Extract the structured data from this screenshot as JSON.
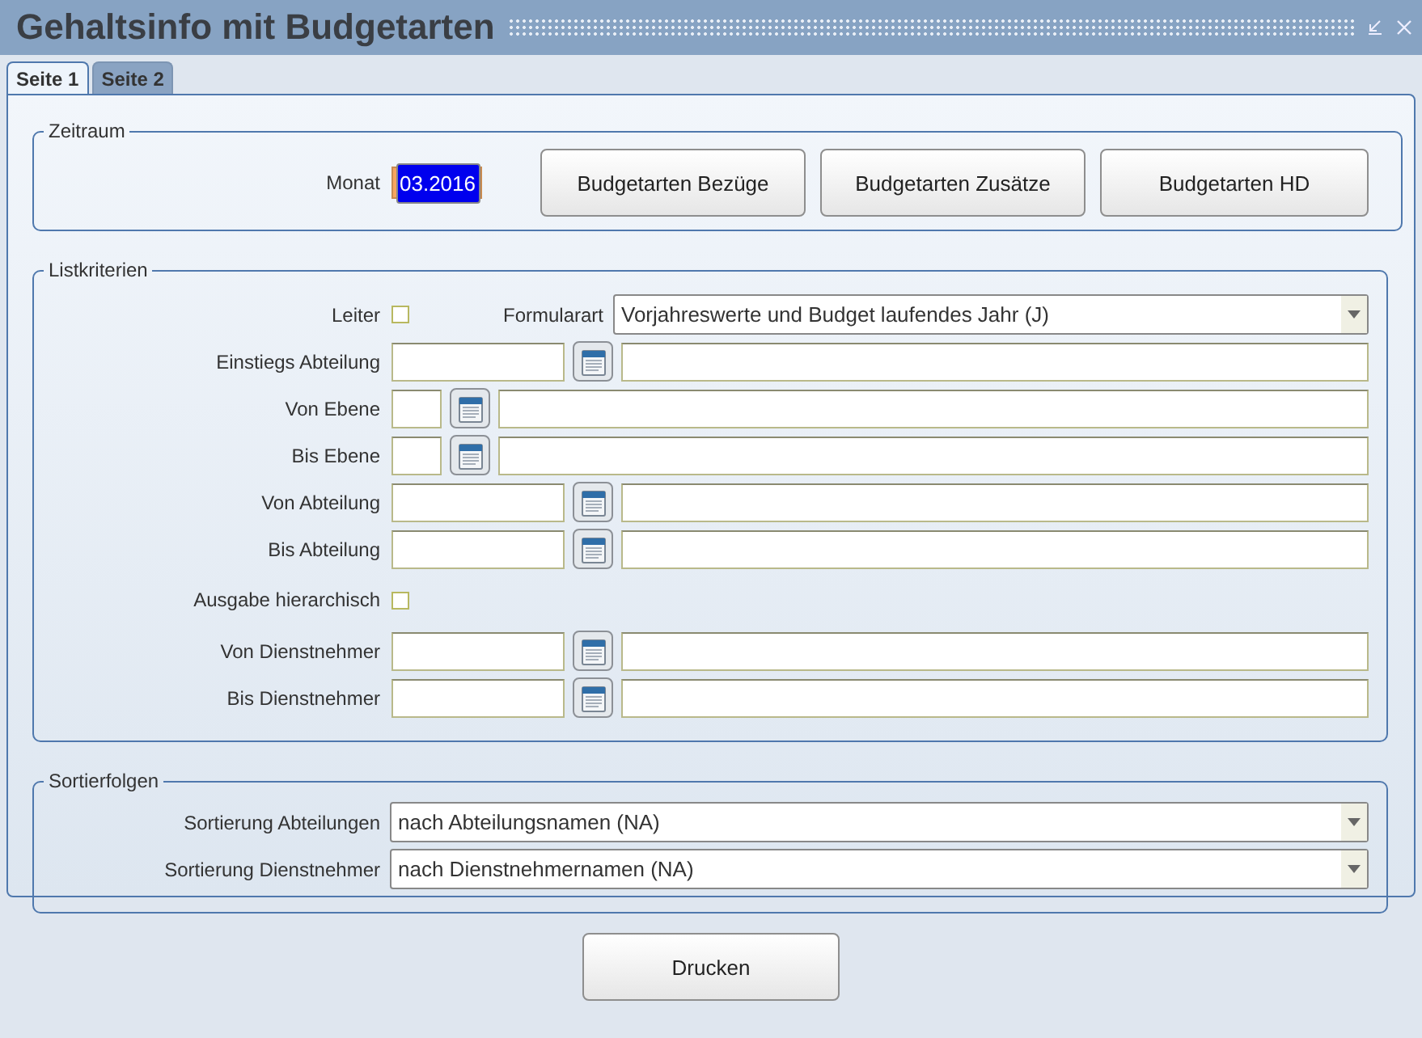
{
  "window": {
    "title": "Gehaltsinfo mit Budgetarten"
  },
  "tabs": [
    {
      "label": "Seite 1",
      "selected": true
    },
    {
      "label": "Seite 2",
      "selected": false
    }
  ],
  "zeitraum": {
    "legend": "Zeitraum",
    "month_label": "Monat",
    "month_value": "03.2016",
    "month_text_selected": true,
    "buttons": [
      "Budgetarten Bezüge",
      "Budgetarten Zusätze",
      "Budgetarten HD"
    ]
  },
  "listkriterien": {
    "legend": "Listkriterien",
    "rows": [
      {
        "kind": "checkbox-select",
        "label": "Leiter",
        "checked": false,
        "select_label": "Formularart",
        "value": "Vorjahreswerte und Budget laufendes Jahr (J)"
      },
      {
        "kind": "lookup",
        "label": "Einstiegs Abteilung"
      },
      {
        "kind": "lookup-short",
        "label": "Von Ebene"
      },
      {
        "kind": "lookup-short",
        "label": "Bis Ebene"
      },
      {
        "kind": "lookup",
        "label": "Von Abteilung"
      },
      {
        "kind": "lookup",
        "label": "Bis Abteilung"
      },
      {
        "kind": "checkbox",
        "label": "Ausgabe hierarchisch",
        "checked": false
      },
      {
        "kind": "lookup",
        "label": "Von Dienstnehmer"
      },
      {
        "kind": "lookup",
        "label": "Bis Dienstnehmer"
      }
    ]
  },
  "sortierfolgen": {
    "legend": "Sortierfolgen",
    "rows": [
      {
        "label": "Sortierung Abteilungen",
        "value": "nach Abteilungsnamen (NA)"
      },
      {
        "label": "Sortierung Dienstnehmer",
        "value": "nach Dienstnehmernamen (NA)"
      }
    ]
  },
  "footer": {
    "button": "Drucken"
  }
}
